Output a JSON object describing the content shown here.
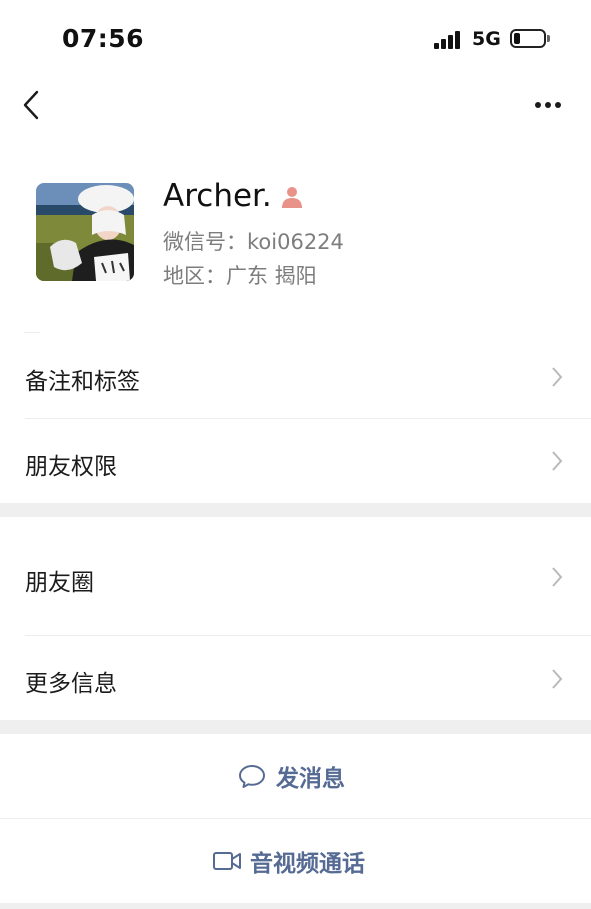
{
  "status_bar": {
    "time": "07:56",
    "network": "5G"
  },
  "profile": {
    "name": "Archer.",
    "wechat_id": "微信号：koi06224",
    "region": "地区：广东 揭阳"
  },
  "menu": {
    "remarks_tags": "备注和标签",
    "friend_permissions": "朋友权限",
    "moments": "朋友圈",
    "more_info": "更多信息"
  },
  "actions": {
    "send_message": "发消息",
    "video_call": "音视频通话"
  },
  "colors": {
    "link_blue": "#566b94",
    "gender_female": "#e8928a",
    "separator": "#efefef"
  },
  "icons": {
    "back": "chevron-left-icon",
    "more": "ellipsis-icon",
    "gender": "female-user-icon",
    "row_arrow": "chevron-right-icon",
    "message": "chat-bubble-icon",
    "video": "video-camera-icon"
  }
}
